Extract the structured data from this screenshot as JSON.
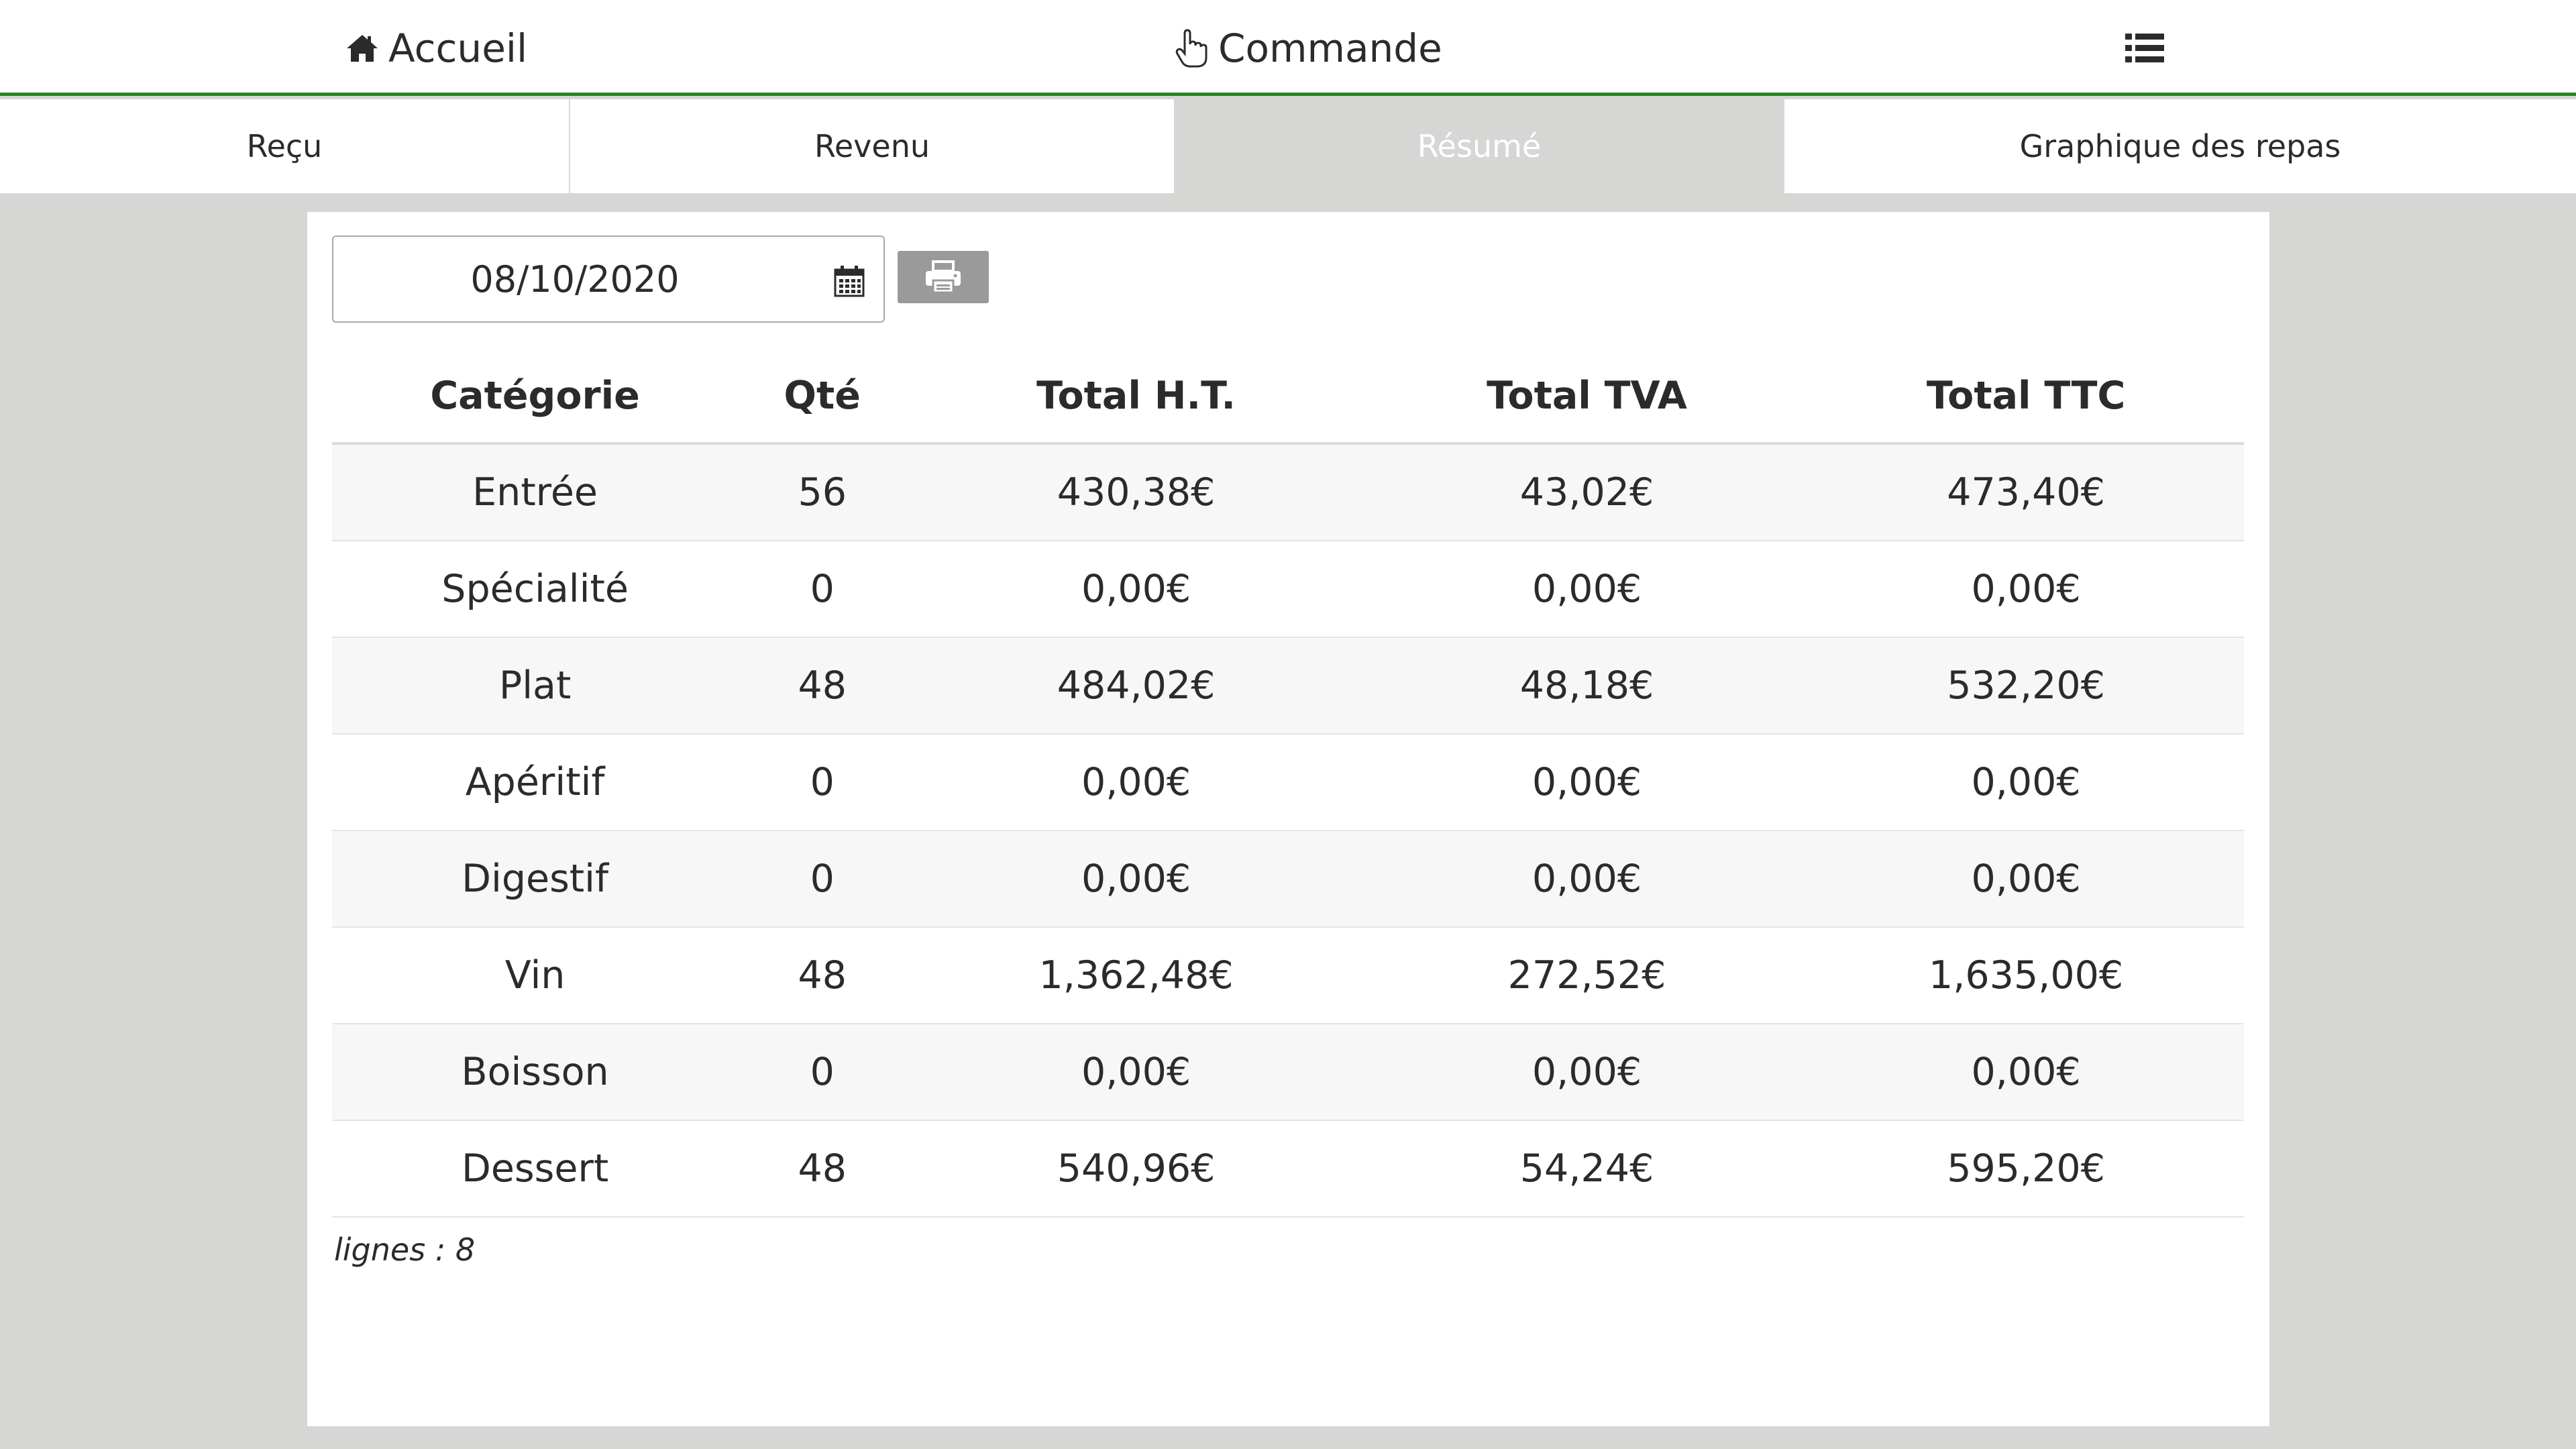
{
  "topnav": {
    "home_label": "Accueil",
    "order_label": "Commande",
    "home_icon": "home-icon",
    "order_icon": "hand-pointer-icon",
    "menu_icon": "list-icon"
  },
  "tabs": [
    {
      "label": "Reçu"
    },
    {
      "label": "Revenu"
    },
    {
      "label": "Résumé",
      "active": true
    },
    {
      "label": "Graphique des repas"
    }
  ],
  "filter": {
    "date": "08/10/2020",
    "calendar_icon": "calendar-icon",
    "print_icon": "print-icon"
  },
  "table": {
    "headers": [
      "Catégorie",
      "Qté",
      "Total H.T.",
      "Total TVA",
      "Total TTC"
    ],
    "rows": [
      [
        "Entrée",
        "56",
        "430,38€",
        "43,02€",
        "473,40€"
      ],
      [
        "Spécialité",
        "0",
        "0,00€",
        "0,00€",
        "0,00€"
      ],
      [
        "Plat",
        "48",
        "484,02€",
        "48,18€",
        "532,20€"
      ],
      [
        "Apéritif",
        "0",
        "0,00€",
        "0,00€",
        "0,00€"
      ],
      [
        "Digestif",
        "0",
        "0,00€",
        "0,00€",
        "0,00€"
      ],
      [
        "Vin",
        "48",
        "1,362,48€",
        "272,52€",
        "1,635,00€"
      ],
      [
        "Boisson",
        "0",
        "0,00€",
        "0,00€",
        "0,00€"
      ],
      [
        "Dessert",
        "48",
        "540,96€",
        "54,24€",
        "595,20€"
      ]
    ]
  },
  "footer": {
    "row_count": "lignes : 8"
  },
  "colors": {
    "accent_green": "#1f8a1f",
    "background": "#d6d6d4",
    "print_button": "#9a9a9a"
  }
}
